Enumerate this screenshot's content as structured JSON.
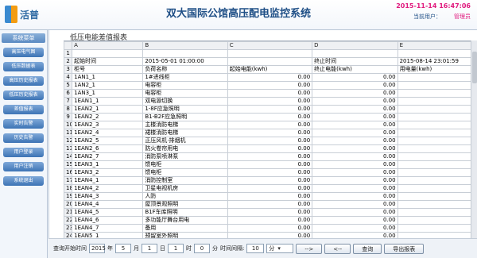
{
  "header": {
    "logo_text": "活普",
    "title": "双大国际公馆高压配电监控系统",
    "datetime": "2015-11-14 16:47:06",
    "user_label": "当前用户：",
    "user_name": "管理员"
  },
  "sidebar": {
    "title": "系统菜单",
    "items": [
      {
        "label": "高压电气图"
      },
      {
        "label": "低压数据表"
      },
      {
        "label": "高压历史报表"
      },
      {
        "label": "低压历史报表"
      },
      {
        "label": "差值报表"
      },
      {
        "label": "实时告警"
      },
      {
        "label": "历史告警"
      },
      {
        "label": "用户登录"
      },
      {
        "label": "用户注销"
      },
      {
        "label": "系统退出"
      }
    ]
  },
  "report": {
    "title": "低压电能差值报表",
    "columns": [
      "A",
      "B",
      "C",
      "D",
      "E"
    ],
    "row1": [
      "",
      "",
      "",
      "",
      ""
    ],
    "row2": [
      "起始时间",
      "2015-05-01 01:00:00",
      "",
      "终止时间",
      "2015-08-14 23:01:59"
    ],
    "row3": [
      "柜号",
      "负荷名称",
      "起始电能(kwh)",
      "终止电能(kwh)",
      "用电量(kwh)"
    ],
    "rows": [
      {
        "n": "4",
        "a": "1AN1_1",
        "b": "1#进线柜",
        "c": "0.00",
        "d": "0.00"
      },
      {
        "n": "5",
        "a": "1AN2_1",
        "b": "电容柜",
        "c": "0.00",
        "d": "0.00"
      },
      {
        "n": "6",
        "a": "1AN3_1",
        "b": "电容柜",
        "c": "0.00",
        "d": "0.00"
      },
      {
        "n": "7",
        "a": "1EAN1_1",
        "b": "双电源切换",
        "c": "0.00",
        "d": "0.00"
      },
      {
        "n": "8",
        "a": "1EAN2_1",
        "b": "1-8F应急照明",
        "c": "0.00",
        "d": "0.00"
      },
      {
        "n": "9",
        "a": "1EAN2_2",
        "b": "B1-B2F应急照明",
        "c": "0.00",
        "d": "0.00"
      },
      {
        "n": "10",
        "a": "1EAN2_3",
        "b": "主楼消防电梯",
        "c": "0.00",
        "d": "0.00"
      },
      {
        "n": "11",
        "a": "1EAN2_4",
        "b": "裙楼消防电梯",
        "c": "0.00",
        "d": "0.00"
      },
      {
        "n": "12",
        "a": "1EAN2_5",
        "b": "正压风机·排烟机",
        "c": "0.00",
        "d": "0.00"
      },
      {
        "n": "13",
        "a": "1EAN2_6",
        "b": "防火卷帘用电",
        "c": "0.00",
        "d": "0.00"
      },
      {
        "n": "14",
        "a": "1EAN2_7",
        "b": "消防泵喷淋泵",
        "c": "0.00",
        "d": "0.00"
      },
      {
        "n": "15",
        "a": "1EAN3_1",
        "b": "馈电柜",
        "c": "0.00",
        "d": "0.00"
      },
      {
        "n": "16",
        "a": "1EAN3_2",
        "b": "馈电柜",
        "c": "0.00",
        "d": "0.00"
      },
      {
        "n": "17",
        "a": "1EAN4_1",
        "b": "消防控制室",
        "c": "0.00",
        "d": "0.00"
      },
      {
        "n": "18",
        "a": "1EAN4_2",
        "b": "卫星电视机房",
        "c": "0.00",
        "d": "0.00"
      },
      {
        "n": "19",
        "a": "1EAN4_3",
        "b": "人防",
        "c": "0.00",
        "d": "0.00"
      },
      {
        "n": "20",
        "a": "1EAN4_4",
        "b": "屋顶景观照明",
        "c": "0.00",
        "d": "0.00"
      },
      {
        "n": "21",
        "a": "1EAN4_5",
        "b": "B1F车库照明",
        "c": "0.00",
        "d": "0.00"
      },
      {
        "n": "22",
        "a": "1EAN4_6",
        "b": "多功能厅舞台用电",
        "c": "0.00",
        "d": "0.00"
      },
      {
        "n": "23",
        "a": "1EAN4_7",
        "b": "备用",
        "c": "0.00",
        "d": "0.00"
      },
      {
        "n": "24",
        "a": "1EAN5_1",
        "b": "预留室外照明",
        "c": "0.00",
        "d": "0.00"
      },
      {
        "n": "25",
        "a": "1EAN5_2",
        "b": "9-16F应急照明",
        "c": "0.00",
        "d": "0.00"
      }
    ]
  },
  "query": {
    "start_label": "查询开始时间",
    "start_year": "2015",
    "year_unit": "年",
    "start_month": "5",
    "month_unit": "月",
    "start_day": "1",
    "day_unit": "日",
    "start_hour": "1",
    "hour_unit": "时",
    "start_min": "0",
    "min_unit": "分",
    "interval_label": "时间间隔:",
    "interval_value": "10",
    "interval_unit": "分",
    "prev_label": "-->",
    "next_label": "<--",
    "query_label": "查询",
    "export_label": "导出报表"
  }
}
